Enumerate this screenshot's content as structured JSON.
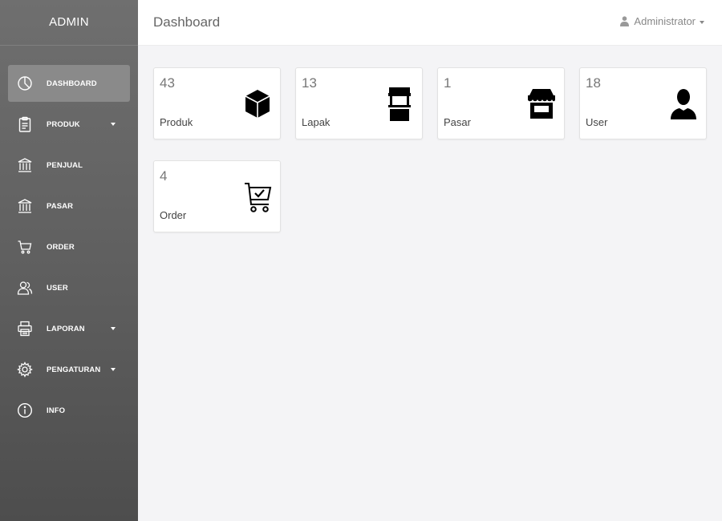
{
  "sidebar": {
    "brand": "ADMIN",
    "items": [
      {
        "label": "DASHBOARD",
        "icon": "dashboard-pie-icon",
        "active": true,
        "has_caret": false
      },
      {
        "label": "PRODUK",
        "icon": "clipboard-icon",
        "active": false,
        "has_caret": true
      },
      {
        "label": "PENJUAL",
        "icon": "bank-icon",
        "active": false,
        "has_caret": false
      },
      {
        "label": "PASAR",
        "icon": "bank-icon",
        "active": false,
        "has_caret": false
      },
      {
        "label": "ORDER",
        "icon": "cart-icon",
        "active": false,
        "has_caret": false
      },
      {
        "label": "USER",
        "icon": "users-icon",
        "active": false,
        "has_caret": false
      },
      {
        "label": "LAPORAN",
        "icon": "printer-icon",
        "active": false,
        "has_caret": true
      },
      {
        "label": "PENGATURAN",
        "icon": "gear-icon",
        "active": false,
        "has_caret": true
      },
      {
        "label": "INFO",
        "icon": "info-icon",
        "active": false,
        "has_caret": false
      }
    ]
  },
  "header": {
    "title": "Dashboard",
    "user": "Administrator"
  },
  "cards": [
    {
      "count": "43",
      "label": "Produk",
      "icon": "box-icon"
    },
    {
      "count": "13",
      "label": "Lapak",
      "icon": "stall-icon"
    },
    {
      "count": "1",
      "label": "Pasar",
      "icon": "store-icon"
    },
    {
      "count": "18",
      "label": "User",
      "icon": "user-icon"
    },
    {
      "count": "4",
      "label": "Order",
      "icon": "cart-check-icon"
    }
  ],
  "colors": {
    "sidebar": "#656565",
    "active_item": "#8a8a8a",
    "background": "#f4f4f6"
  }
}
